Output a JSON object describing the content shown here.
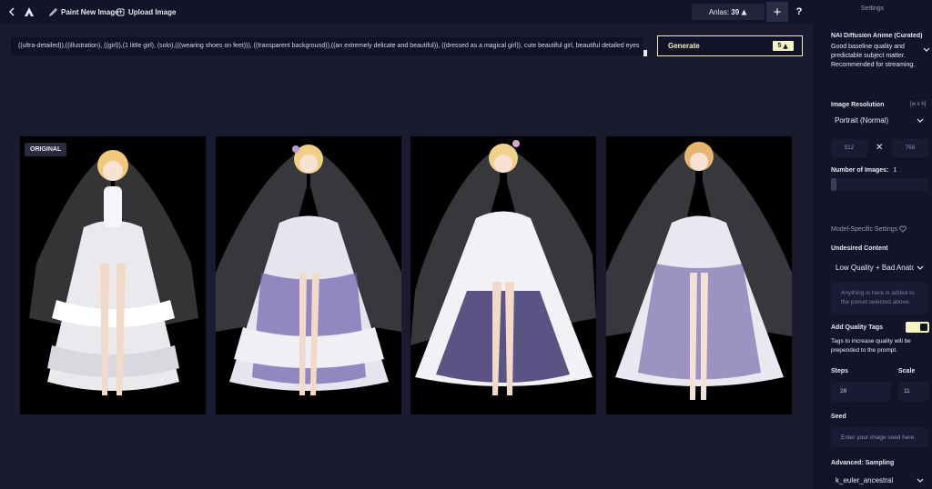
{
  "topbar": {
    "paint_label": "Paint New Image",
    "upload_label": "Upload Image",
    "anlas_label": "Anlas:",
    "anlas_value": "39",
    "plus_label": "+",
    "help_label": "?"
  },
  "prompt": {
    "text": "((ultra-detailed)),((illustration), ((girl)),(1 little girl), (solo),(((wearing shoes on feet))), ((transparent background)),((an extremely delicate and beautiful)), ((dressed as a magical girl)), cute beautiful girl, beautiful detailed eyes"
  },
  "generate": {
    "label": "Generate",
    "cost": "5"
  },
  "images": {
    "original_tag": "ORIGINAL"
  },
  "settings": {
    "title": "Settings",
    "model_name": "NAI Diffusion Anime (Curated)",
    "model_desc": "Good baseline quality and predictable subject matter. Recommended for streaming.",
    "resolution_label": "Image Resolution",
    "resolution_hint": "[w x h]",
    "resolution_value": "Portrait (Normal)",
    "width": "512",
    "height": "768",
    "times_glyph": "✕",
    "num_images_label": "Number of Images:",
    "num_images_value": "1",
    "model_specific_label": "Model-Specific Settings",
    "undesired_label": "Undesired Content",
    "undesired_value": "Low Quality + Bad Anatomy",
    "undesired_placeholder": "Anything in here is added to the preset selected above.",
    "quality_tags_label": "Add Quality Tags",
    "quality_tags_desc": "Tags to increase quality will be prepended to the prompt.",
    "steps_label": "Steps",
    "steps_value": "28",
    "scale_label": "Scale",
    "scale_value": "11",
    "seed_label": "Seed",
    "seed_placeholder": "Enter your image seed here.",
    "sampling_label": "Advanced: Sampling",
    "sampling_value": "k_euler_ancestral"
  },
  "colors": {
    "background": "#1a1b2e",
    "panel": "#13142a",
    "accent": "#f5f3c2"
  }
}
